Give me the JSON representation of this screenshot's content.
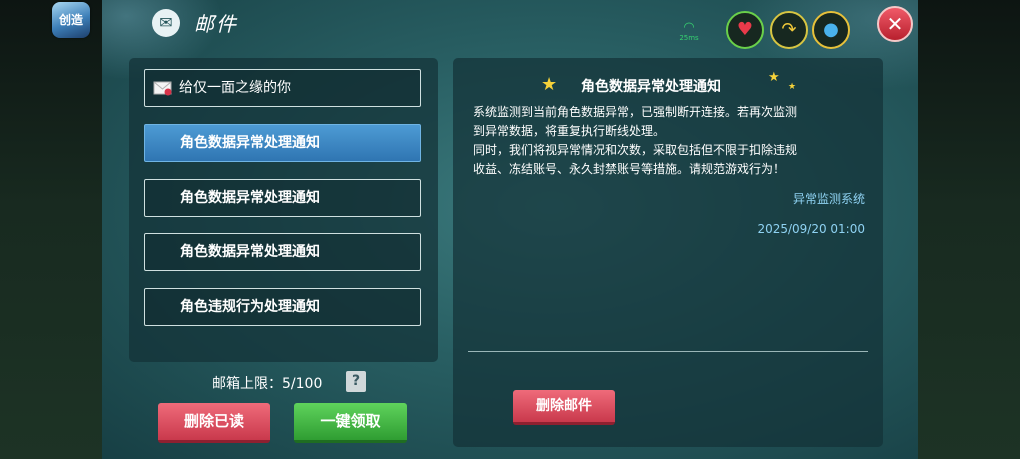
{
  "app": {
    "icon_label": "创造"
  },
  "header": {
    "title": "邮件",
    "ping": "25ms"
  },
  "status": {
    "health_icon": "heart-icon",
    "energy_icon": "energy-icon",
    "water_icon": "water-icon"
  },
  "mail_list": {
    "items": [
      {
        "label": "给仅一面之缘的你",
        "has_icon": true
      },
      {
        "label": "角色数据异常处理通知",
        "selected": true
      },
      {
        "label": "角色数据异常处理通知"
      },
      {
        "label": "角色数据异常处理通知"
      },
      {
        "label": "角色违规行为处理通知"
      }
    ]
  },
  "capacity": {
    "label": "邮箱上限：5/100",
    "help": "?"
  },
  "buttons": {
    "delete_read": "删除已读",
    "claim_all": "一键领取",
    "delete_mail": "删除邮件"
  },
  "detail": {
    "title": "角色数据异常处理通知",
    "lines": [
      "系统监测到当前角色数据异常，已强制断开连接。若再次监测",
      "到异常数据，将重复执行断线处理。",
      "同时，我们将视异常情况和次数，采取包括但不限于扣除违规",
      "收益、冻结账号、永久封禁账号等措施。请规范游戏行为！"
    ],
    "sender": "异常监测系统",
    "date": "2025/09/20 01:00"
  },
  "colors": {
    "selected_blue": "#3f8bc8",
    "red_button": "#d8485a",
    "green_button": "#41b243",
    "link_blue": "#8fd2f2"
  }
}
